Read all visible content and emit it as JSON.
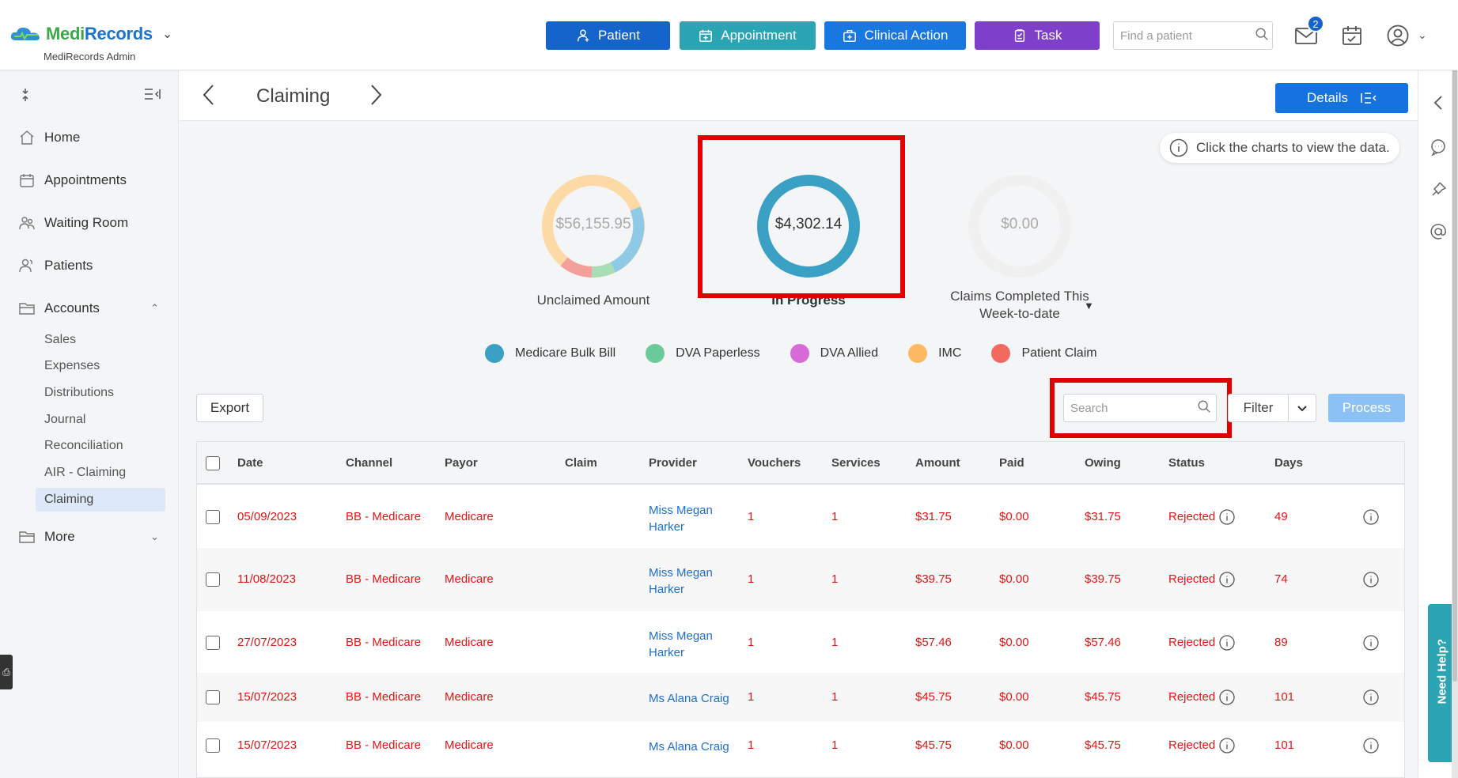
{
  "brand": {
    "name_part1": "Medi",
    "name_part2": "Records",
    "subtitle": "MediRecords Admin"
  },
  "header": {
    "buttons": {
      "patient": "Patient",
      "appointment": "Appointment",
      "clinical_action": "Clinical Action",
      "task": "Task"
    },
    "search_placeholder": "Find a patient",
    "mail_badge": "2"
  },
  "sidebar": {
    "items": [
      {
        "label": "Home",
        "icon": "home-icon"
      },
      {
        "label": "Appointments",
        "icon": "calendar-icon"
      },
      {
        "label": "Waiting Room",
        "icon": "people-icon"
      },
      {
        "label": "Patients",
        "icon": "patients-icon"
      },
      {
        "label": "Accounts",
        "icon": "folder-icon"
      },
      {
        "label": "More",
        "icon": "folder-icon"
      }
    ],
    "accounts_sub": [
      "Sales",
      "Expenses",
      "Distributions",
      "Journal",
      "Reconciliation",
      "AIR - Claiming",
      "Claiming"
    ]
  },
  "page": {
    "title": "Claiming",
    "details_button": "Details"
  },
  "hint": "Click the charts to view the data.",
  "charts": {
    "unclaimed": {
      "value": "$56,155.95",
      "label": "Unclaimed Amount"
    },
    "in_progress": {
      "value": "$4,302.14",
      "label": "In Progress"
    },
    "completed": {
      "value": "$0.00",
      "label_line1": "Claims Completed This",
      "label_line2": "Week-to-date"
    }
  },
  "legend": [
    {
      "label": "Medicare Bulk Bill",
      "color": "#3aa0c4"
    },
    {
      "label": "DVA Paperless",
      "color": "#6cc99a"
    },
    {
      "label": "DVA Allied",
      "color": "#d86bd8"
    },
    {
      "label": "IMC",
      "color": "#fdb963"
    },
    {
      "label": "Patient Claim",
      "color": "#f26a5f"
    }
  ],
  "toolbar": {
    "export": "Export",
    "search_placeholder": "Search",
    "filter": "Filter",
    "process": "Process"
  },
  "table": {
    "headers": [
      "Date",
      "Channel",
      "Payor",
      "Claim",
      "Provider",
      "Vouchers",
      "Services",
      "Amount",
      "Paid",
      "Owing",
      "Status",
      "Days"
    ],
    "rows": [
      {
        "date": "05/09/2023",
        "channel": "BB - Medicare",
        "payor": "Medicare",
        "claim": "",
        "provider_line1": "Miss Megan",
        "provider_line2": "Harker",
        "vouchers": "1",
        "services": "1",
        "amount": "$31.75",
        "paid": "$0.00",
        "owing": "$31.75",
        "status": "Rejected",
        "days": "49"
      },
      {
        "date": "11/08/2023",
        "channel": "BB - Medicare",
        "payor": "Medicare",
        "claim": "",
        "provider_line1": "Miss Megan",
        "provider_line2": "Harker",
        "vouchers": "1",
        "services": "1",
        "amount": "$39.75",
        "paid": "$0.00",
        "owing": "$39.75",
        "status": "Rejected",
        "days": "74"
      },
      {
        "date": "27/07/2023",
        "channel": "BB - Medicare",
        "payor": "Medicare",
        "claim": "",
        "provider_line1": "Miss Megan",
        "provider_line2": "Harker",
        "vouchers": "1",
        "services": "1",
        "amount": "$57.46",
        "paid": "$0.00",
        "owing": "$57.46",
        "status": "Rejected",
        "days": "89"
      },
      {
        "date": "15/07/2023",
        "channel": "BB - Medicare",
        "payor": "Medicare",
        "claim": "",
        "provider_line1": "Ms Alana Craig",
        "provider_line2": "",
        "vouchers": "1",
        "services": "1",
        "amount": "$45.75",
        "paid": "$0.00",
        "owing": "$45.75",
        "status": "Rejected",
        "days": "101"
      },
      {
        "date": "15/07/2023",
        "channel": "BB - Medicare",
        "payor": "Medicare",
        "claim": "",
        "provider_line1": "Ms Alana Craig",
        "provider_line2": "",
        "vouchers": "1",
        "services": "1",
        "amount": "$45.75",
        "paid": "$0.00",
        "owing": "$45.75",
        "status": "Rejected",
        "days": "101"
      }
    ]
  },
  "need_help": "Need Help?"
}
